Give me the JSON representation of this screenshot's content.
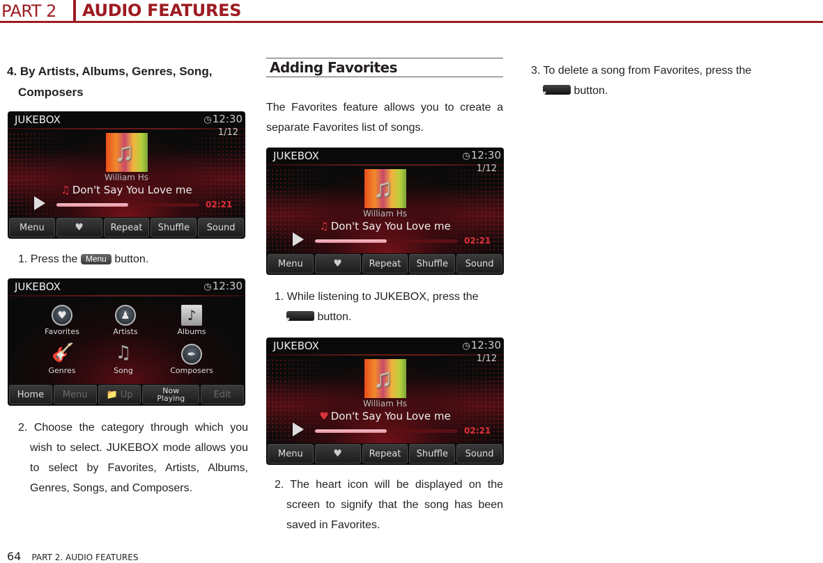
{
  "header": {
    "part": "PART 2",
    "title": "AUDIO FEATURES"
  },
  "footer": {
    "page_number": "64",
    "section": "PART 2. AUDIO FEATURES"
  },
  "column1": {
    "heading_line1": "4. By Artists, Albums, Genres, Song,",
    "heading_line2": "Composers",
    "step1_prefix": "1. Press the",
    "step1_button": "Menu",
    "step1_suffix": "button.",
    "step2": "2. Choose the category through which you wish to select. JUKEBOX mode allows you to select by Favorites, Artists, Albums, Genres, Songs, and Composers."
  },
  "column2": {
    "section_title": "Adding Favorites",
    "intro": "The Favorites feature allows you to create a separate Favorites list of songs.",
    "step1_text": "1. While listening to JUKEBOX, press the",
    "step1_suffix": "button.",
    "step2": "2. The heart icon will be displayed on the screen to signify that the song has been saved in Favorites."
  },
  "column3": {
    "step3_text": "3. To delete a song from Favorites, press the",
    "step3_suffix": "button."
  },
  "player_screen": {
    "title": "JUKEBOX",
    "clock": "12:30",
    "track_index": "1/12",
    "artist": "William Hs",
    "song": "Don't Say You Love me",
    "elapsed": "02:21",
    "progress_fraction": 0.5,
    "song_icon_default": "music-note",
    "song_icon_favorite": "heart",
    "buttons": [
      "Menu",
      "♥",
      "Repeat",
      "Shuffle",
      "Sound"
    ],
    "accent_color": "#e0323a"
  },
  "menu_screen": {
    "title": "JUKEBOX",
    "clock": "12:30",
    "categories": [
      {
        "label": "Favorites",
        "icon": "heart"
      },
      {
        "label": "Artists",
        "icon": "person"
      },
      {
        "label": "Albums",
        "icon": "music-note"
      },
      {
        "label": "Genres",
        "icon": "guitar"
      },
      {
        "label": "Song",
        "icon": "music-notes"
      },
      {
        "label": "Composers",
        "icon": "pen-nib"
      }
    ],
    "buttons": [
      "Home",
      "Menu",
      "Up",
      "Now Playing",
      "Edit"
    ]
  },
  "colors": {
    "brand": "#9c1c22"
  }
}
